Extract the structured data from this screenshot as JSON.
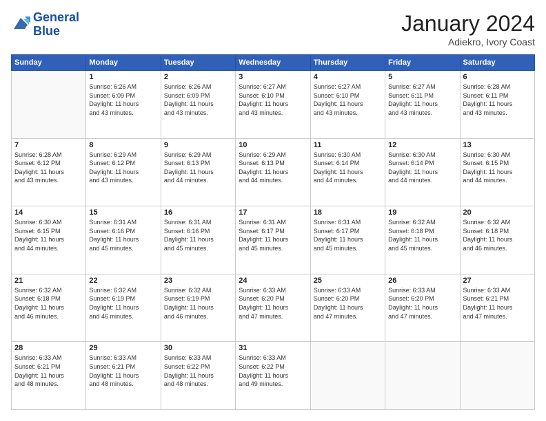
{
  "header": {
    "logo_line1": "General",
    "logo_line2": "Blue",
    "month_title": "January 2024",
    "location": "Adiekro, Ivory Coast"
  },
  "weekdays": [
    "Sunday",
    "Monday",
    "Tuesday",
    "Wednesday",
    "Thursday",
    "Friday",
    "Saturday"
  ],
  "weeks": [
    [
      {
        "day": null
      },
      {
        "day": "1",
        "sunrise": "6:26 AM",
        "sunset": "6:09 PM",
        "daylight": "11 hours and 43 minutes."
      },
      {
        "day": "2",
        "sunrise": "6:26 AM",
        "sunset": "6:09 PM",
        "daylight": "11 hours and 43 minutes."
      },
      {
        "day": "3",
        "sunrise": "6:27 AM",
        "sunset": "6:10 PM",
        "daylight": "11 hours and 43 minutes."
      },
      {
        "day": "4",
        "sunrise": "6:27 AM",
        "sunset": "6:10 PM",
        "daylight": "11 hours and 43 minutes."
      },
      {
        "day": "5",
        "sunrise": "6:27 AM",
        "sunset": "6:11 PM",
        "daylight": "11 hours and 43 minutes."
      },
      {
        "day": "6",
        "sunrise": "6:28 AM",
        "sunset": "6:11 PM",
        "daylight": "11 hours and 43 minutes."
      }
    ],
    [
      {
        "day": "7",
        "sunrise": "6:28 AM",
        "sunset": "6:12 PM",
        "daylight": "11 hours and 43 minutes."
      },
      {
        "day": "8",
        "sunrise": "6:29 AM",
        "sunset": "6:12 PM",
        "daylight": "11 hours and 43 minutes."
      },
      {
        "day": "9",
        "sunrise": "6:29 AM",
        "sunset": "6:13 PM",
        "daylight": "11 hours and 44 minutes."
      },
      {
        "day": "10",
        "sunrise": "6:29 AM",
        "sunset": "6:13 PM",
        "daylight": "11 hours and 44 minutes."
      },
      {
        "day": "11",
        "sunrise": "6:30 AM",
        "sunset": "6:14 PM",
        "daylight": "11 hours and 44 minutes."
      },
      {
        "day": "12",
        "sunrise": "6:30 AM",
        "sunset": "6:14 PM",
        "daylight": "11 hours and 44 minutes."
      },
      {
        "day": "13",
        "sunrise": "6:30 AM",
        "sunset": "6:15 PM",
        "daylight": "11 hours and 44 minutes."
      }
    ],
    [
      {
        "day": "14",
        "sunrise": "6:30 AM",
        "sunset": "6:15 PM",
        "daylight": "11 hours and 44 minutes."
      },
      {
        "day": "15",
        "sunrise": "6:31 AM",
        "sunset": "6:16 PM",
        "daylight": "11 hours and 45 minutes."
      },
      {
        "day": "16",
        "sunrise": "6:31 AM",
        "sunset": "6:16 PM",
        "daylight": "11 hours and 45 minutes."
      },
      {
        "day": "17",
        "sunrise": "6:31 AM",
        "sunset": "6:17 PM",
        "daylight": "11 hours and 45 minutes."
      },
      {
        "day": "18",
        "sunrise": "6:31 AM",
        "sunset": "6:17 PM",
        "daylight": "11 hours and 45 minutes."
      },
      {
        "day": "19",
        "sunrise": "6:32 AM",
        "sunset": "6:18 PM",
        "daylight": "11 hours and 45 minutes."
      },
      {
        "day": "20",
        "sunrise": "6:32 AM",
        "sunset": "6:18 PM",
        "daylight": "11 hours and 46 minutes."
      }
    ],
    [
      {
        "day": "21",
        "sunrise": "6:32 AM",
        "sunset": "6:18 PM",
        "daylight": "11 hours and 46 minutes."
      },
      {
        "day": "22",
        "sunrise": "6:32 AM",
        "sunset": "6:19 PM",
        "daylight": "11 hours and 46 minutes."
      },
      {
        "day": "23",
        "sunrise": "6:32 AM",
        "sunset": "6:19 PM",
        "daylight": "11 hours and 46 minutes."
      },
      {
        "day": "24",
        "sunrise": "6:33 AM",
        "sunset": "6:20 PM",
        "daylight": "11 hours and 47 minutes."
      },
      {
        "day": "25",
        "sunrise": "6:33 AM",
        "sunset": "6:20 PM",
        "daylight": "11 hours and 47 minutes."
      },
      {
        "day": "26",
        "sunrise": "6:33 AM",
        "sunset": "6:20 PM",
        "daylight": "11 hours and 47 minutes."
      },
      {
        "day": "27",
        "sunrise": "6:33 AM",
        "sunset": "6:21 PM",
        "daylight": "11 hours and 47 minutes."
      }
    ],
    [
      {
        "day": "28",
        "sunrise": "6:33 AM",
        "sunset": "6:21 PM",
        "daylight": "11 hours and 48 minutes."
      },
      {
        "day": "29",
        "sunrise": "6:33 AM",
        "sunset": "6:21 PM",
        "daylight": "11 hours and 48 minutes."
      },
      {
        "day": "30",
        "sunrise": "6:33 AM",
        "sunset": "6:22 PM",
        "daylight": "11 hours and 48 minutes."
      },
      {
        "day": "31",
        "sunrise": "6:33 AM",
        "sunset": "6:22 PM",
        "daylight": "11 hours and 49 minutes."
      },
      {
        "day": null
      },
      {
        "day": null
      },
      {
        "day": null
      }
    ]
  ],
  "labels": {
    "sunrise_prefix": "Sunrise: ",
    "sunset_prefix": "Sunset: ",
    "daylight_prefix": "Daylight: "
  }
}
